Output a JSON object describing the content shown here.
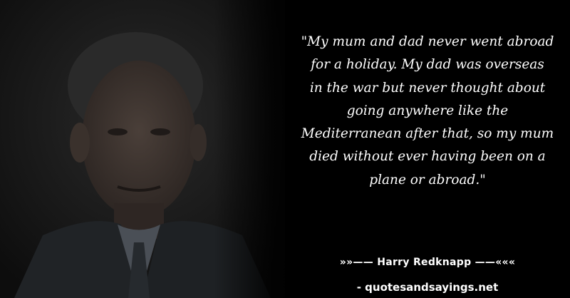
{
  "quote": {
    "lines": [
      "\"My mum and dad never went abroad",
      "for a holiday. My dad was overseas",
      "in the war but never thought about",
      "going anywhere like the",
      "Mediterranean after that, so my mum",
      "died without ever having been on a",
      "plane or abroad.\""
    ]
  },
  "author": {
    "text": "»»—— Harry Redknapp ——«««"
  },
  "site": {
    "text": "- quotesandsayings.net"
  },
  "colors": {
    "background": "#000000",
    "text": "#ffffff"
  }
}
